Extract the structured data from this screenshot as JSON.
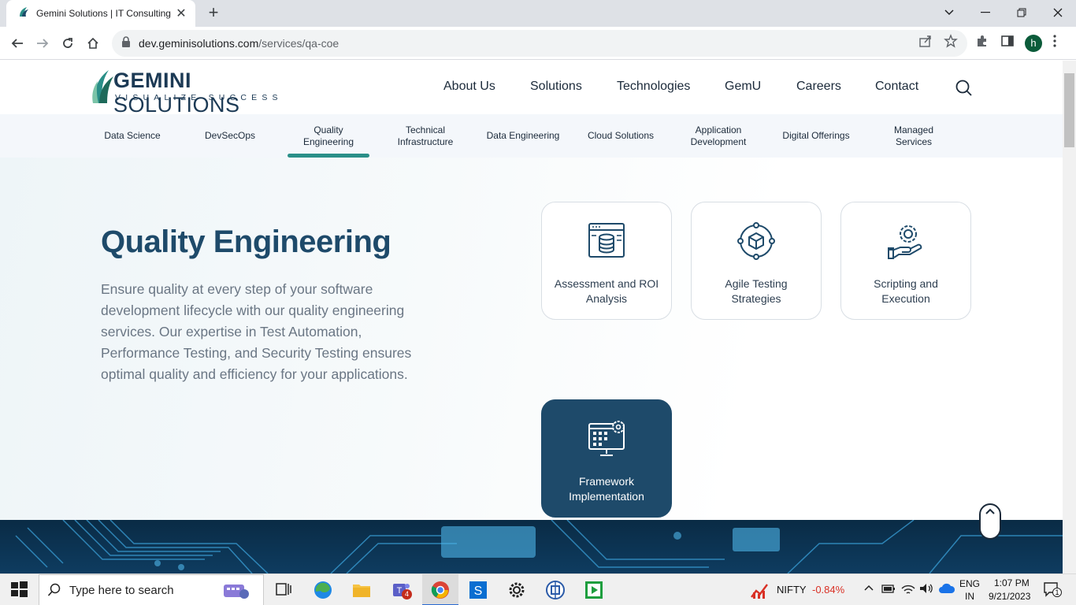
{
  "browser": {
    "tab_title": "Gemini Solutions | IT Consulting",
    "url_host": "dev.geminisolutions.com",
    "url_path": "/services/qa-coe",
    "profile_initial": "h"
  },
  "site": {
    "logo_main": "GEMINI",
    "logo_second": "SOLUTIONS",
    "logo_tagline": "VISUALIZE SUCCESS",
    "nav": [
      "About Us",
      "Solutions",
      "Technologies",
      "GemU",
      "Careers",
      "Contact"
    ],
    "subnav": [
      "Data Science",
      "DevSecOps",
      "Quality Engineering",
      "Technical Infrastructure",
      "Data Engineering",
      "Cloud Solutions",
      "Application Development",
      "Digital Offerings",
      "Managed Services"
    ]
  },
  "hero": {
    "title": "Quality Engineering",
    "description": "Ensure quality at every step of your software development lifecycle with our quality engineering services. Our expertise in Test Automation, Performance Testing, and Security Testing ensures optimal quality and efficiency for your applications."
  },
  "cards": [
    {
      "title": "Assessment and ROI Analysis",
      "icon": "database-window-icon"
    },
    {
      "title": "Agile Testing Strategies",
      "icon": "network-cube-icon"
    },
    {
      "title": "Scripting and Execution",
      "icon": "hand-gear-icon"
    },
    {
      "title": "Framework Implementation",
      "icon": "monitor-gear-icon"
    }
  ],
  "taskbar": {
    "search_placeholder": "Type here to search",
    "teams_badge": "4",
    "nifty_label": "NIFTY",
    "nifty_change": "-0.84%",
    "lang_1": "ENG",
    "lang_2": "IN",
    "time": "1:07 PM",
    "date": "9/21/2023",
    "notif_count": "1"
  },
  "colors": {
    "brand_dark": "#1e4a6a",
    "accent_teal": "#2a8f88",
    "nifty_red": "#d93025"
  }
}
